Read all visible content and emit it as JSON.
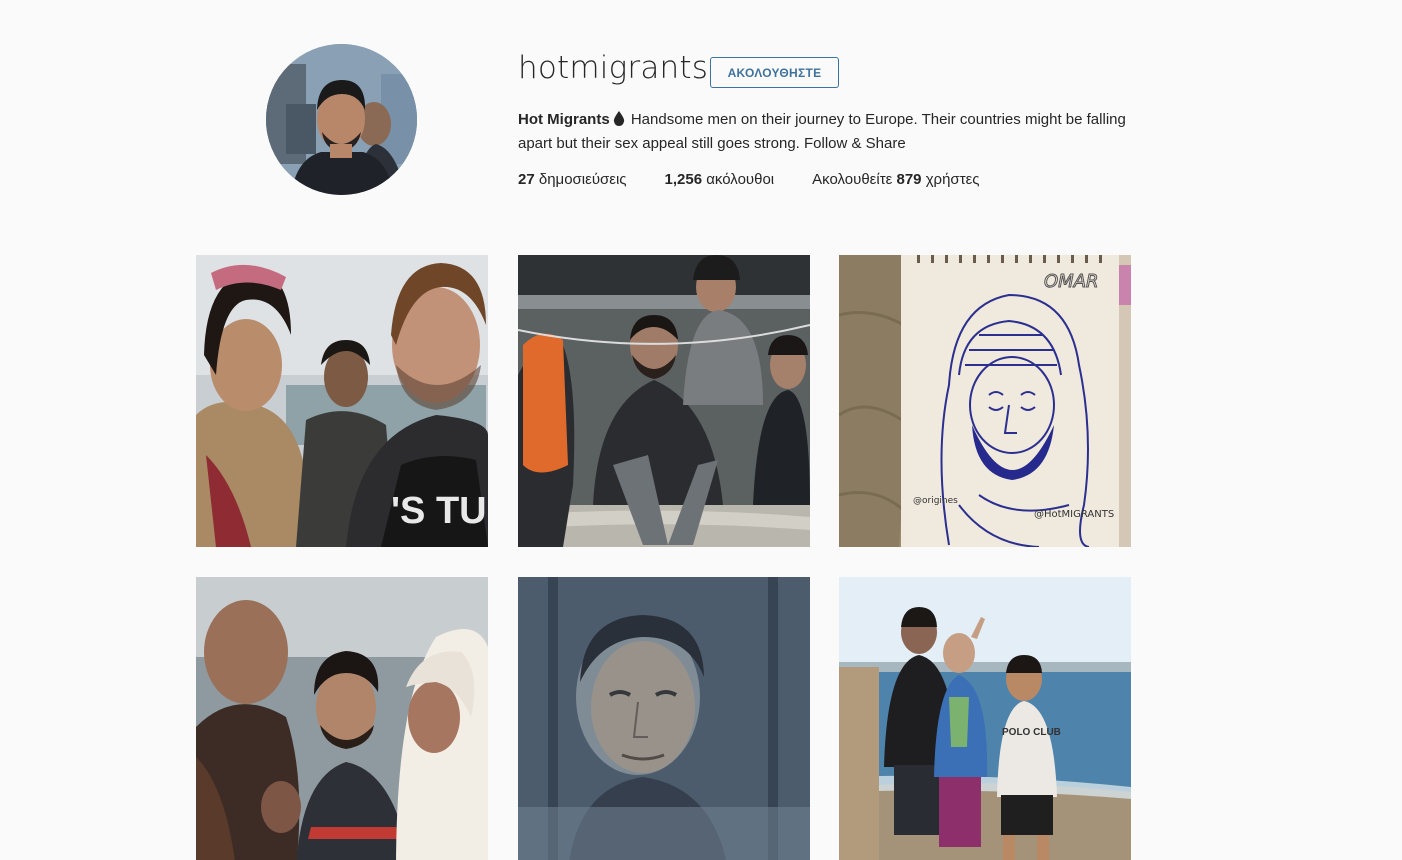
{
  "profile": {
    "username": "hotmigrants",
    "follow_button": "ΑΚΟΛΟΥΘΗΣΤΕ",
    "full_name": "Hot Migrants",
    "bio_icon": "drop-icon",
    "bio_text": "Handsome men on their journey to Europe. Their countries might be falling apart but their sex appeal still goes strong. Follow & Share",
    "stats": {
      "posts_count": "27",
      "posts_label": "δημοσιεύσεις",
      "followers_count": "1,256",
      "followers_label": "ακόλουθοι",
      "following_prefix": "Ακολουθείτε",
      "following_count": "879",
      "following_label": "χρήστες"
    }
  },
  "posts": [
    {
      "name": "post-1"
    },
    {
      "name": "post-2"
    },
    {
      "name": "post-3",
      "drawing_title": "OMAR",
      "drawing_credit": "@origines",
      "drawing_handle": "@HotMIGRANTS"
    },
    {
      "name": "post-4"
    },
    {
      "name": "post-5"
    },
    {
      "name": "post-6",
      "shirt_text": "POLO CLUB"
    }
  ],
  "colors": {
    "background": "#fafafa",
    "accent": "#3f729b",
    "text": "#262626"
  }
}
